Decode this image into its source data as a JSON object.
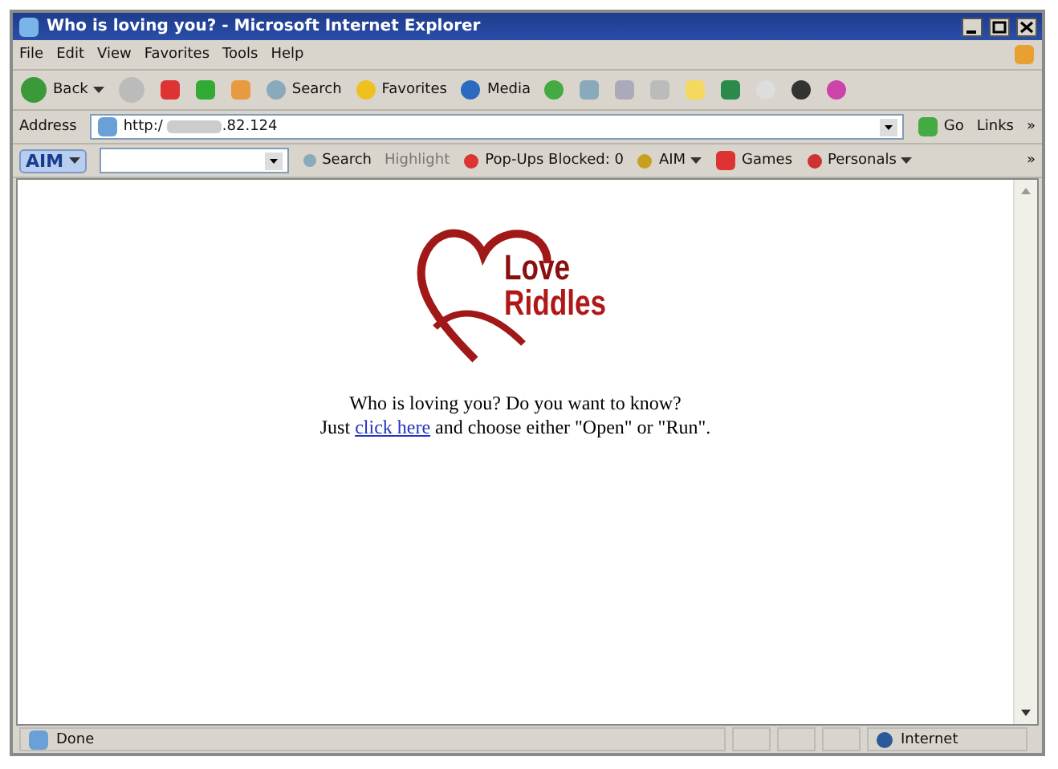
{
  "window": {
    "title": "Who is loving you? - Microsoft Internet Explorer"
  },
  "menu": [
    "File",
    "Edit",
    "View",
    "Favorites",
    "Tools",
    "Help"
  ],
  "toolbar": {
    "back": "Back",
    "search": "Search",
    "favorites": "Favorites",
    "media": "Media"
  },
  "address": {
    "label": "Address",
    "prefix": "http:/",
    "suffix": ".82.124",
    "go": "Go",
    "links": "Links",
    "more": "»"
  },
  "aim_bar": {
    "logo": "AIM",
    "search": "Search",
    "highlight": "Highlight",
    "popups": "Pop-Ups Blocked: 0",
    "aim": "AIM",
    "games": "Games",
    "personals": "Personals",
    "more": "»"
  },
  "page": {
    "logo": [
      "Love",
      "Riddles"
    ],
    "line1": "Who is loving you? Do you want to know?",
    "line2_before": "Just ",
    "link": "click here",
    "line2_after": " and choose either \"Open\" or \"Run\"."
  },
  "status_bar": {
    "text": "Done",
    "zone": "Internet"
  }
}
